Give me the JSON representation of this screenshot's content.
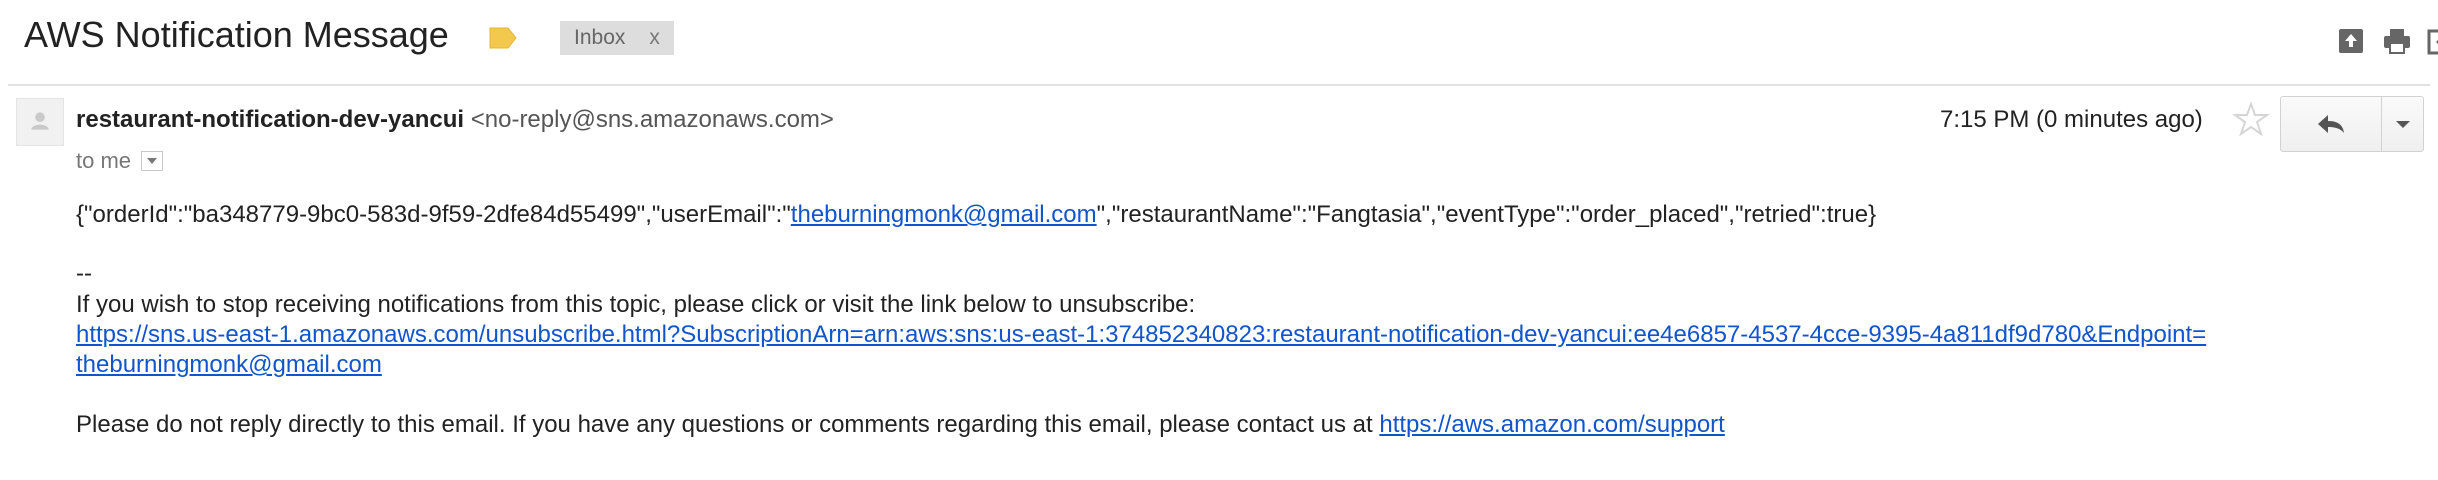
{
  "subject": "AWS Notification Message",
  "labels": {
    "inbox": "Inbox",
    "remove": "x"
  },
  "label_color": "#f2c94c",
  "icons": [
    "label-tag-icon",
    "move-to-inbox-icon",
    "print-icon",
    "open-new-window-icon",
    "person-icon",
    "star-icon",
    "reply-icon",
    "chevron-down-icon"
  ],
  "message": {
    "sender_name": "restaurant-notification-dev-yancui",
    "sender_email": "<no-reply@sns.amazonaws.com>",
    "to": "to me",
    "date": "7:15 PM (0 minutes ago)",
    "body": {
      "json_prefix": "{\"orderId\":\"ba348779-9bc0-583d-9f59-2dfe84d55499\",\"userEmail\":\"",
      "json_email": "theburningmonk@gmail.com",
      "json_suffix": "\",\"restaurantName\":\"Fangtasia\",\"eventType\":\"order_placed\",\"retried\":true}",
      "separator": "--",
      "unsubscribe_intro": "If you wish to stop receiving notifications from this topic, please click or visit the link below to unsubscribe:",
      "unsubscribe_link_line1": "https://sns.us-east-1.amazonaws.com/unsubscribe.html?SubscriptionArn=arn:aws:sns:us-east-1:374852340823:restaurant-notification-dev-yancui:ee4e6857-4537-4cce-9395-4a811df9d780&Endpoint=",
      "unsubscribe_link_line2": "theburningmonk@gmail.com",
      "footer_text": "Please do not reply directly to this email. If you have any questions or comments regarding this email, please contact us at ",
      "support_link": "https://aws.amazon.com/support"
    }
  }
}
